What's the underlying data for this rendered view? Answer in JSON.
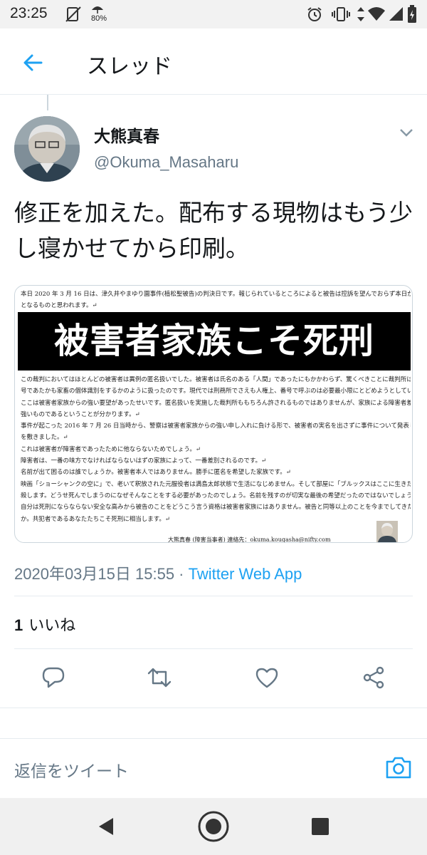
{
  "status_bar": {
    "time": "23:25",
    "battery_percent": "80%",
    "icons": [
      "notification-off-icon",
      "umbrella-icon",
      "alarm-icon",
      "vibrate-icon",
      "data-arrows-icon",
      "wifi-icon",
      "signal-icon",
      "battery-icon"
    ]
  },
  "header": {
    "title": "スレッド",
    "back_icon": "arrow-left-icon"
  },
  "tweet": {
    "author_name": "大熊真春",
    "author_handle": "@Okuma_Masaharu",
    "text": "修正を加えた。配布する現物はもう少し寝かせてから印刷。",
    "media": {
      "top_text": [
        "本日 2020 年 3 月 16 日は、津久井やまゆり園事件(植松聖被告)の判決日です。報じられているところによると被告は控訴を望んでおらず本日が公判最終日",
        "となるものと思われます。↵"
      ],
      "headline": "被害者家族こそ死刑",
      "body_lines": [
        "この裁判においてはほとんどの被害者は異例の匿名扱いでした。被害者は氏名のある「人間」であったにもかかわらず、驚くべきことに裁判所は「甲Ｏ」などの記",
        "号であたかも家畜の個体識別をするかのように扱ったのです。現代では刑務所でさえも人権上、番号で呼ぶのは必要最小限にとどめようとしているというのに。↵",
        "ここは被害者家族からの強い要望があったせいです。匿名扱いを実施した裁判所ももちろん許されるものではありませんが、家族による障害者差別がとても",
        "強いものであるということが分かります。↵",
        "事件が起こった 2016 年 7 月 26 日当時から、警察は被害者家族からの強い申し入れに負ける形で、被害者の実名を出さずに事件について発表し、かん口令",
        "を敷きました。↵",
        "これは被害者が障害者であったために他ならないためでしょう。↵",
        "障害者は、一番の味方でなければならないはずの家族によって、一番差別されるのです。↵",
        "名前が出て困るのは誰でしょうか。被害者本人ではありません。勝手に匿名を希望した家族です。↵",
        "映画「ショーシャンクの空に」で、老いて釈放された元服役者は満島太郎状態で生活になじめません。そして部屋に「ブルックスはここに生きた」と落書きをして自",
        "殺します。どうせ死んでしまうのになぜそんなことをする必要があったのでしょう。名前を残すのが切実な最後の希望だったのではないでしょうか。↵",
        "自分は死刑にならならない安全な高みから被告のことをどうこう言う資格は被害者家族にはありません。被告と同等以上のことを今までしてきたのではありません",
        "か。共犯者であるあなたたちこそ死刑に相当します。↵"
      ],
      "signature": "大熊真春 (障害当事者)  連絡先：okuma.kougasha@nifty.com"
    },
    "timestamp": "2020年03月15日 15:55",
    "separator": " · ",
    "client": "Twitter Web App",
    "like_count": "1",
    "like_label": "いいね"
  },
  "actions": [
    "reply-icon",
    "retweet-icon",
    "like-icon",
    "share-icon"
  ],
  "reply_placeholder": "返信をツイート",
  "nav": [
    "back-triangle-icon",
    "home-circle-icon",
    "recents-square-icon"
  ],
  "colors": {
    "accent": "#1da1f2",
    "secondary_text": "#657786",
    "primary_text": "#14171a",
    "icon_gray": "#657786"
  }
}
